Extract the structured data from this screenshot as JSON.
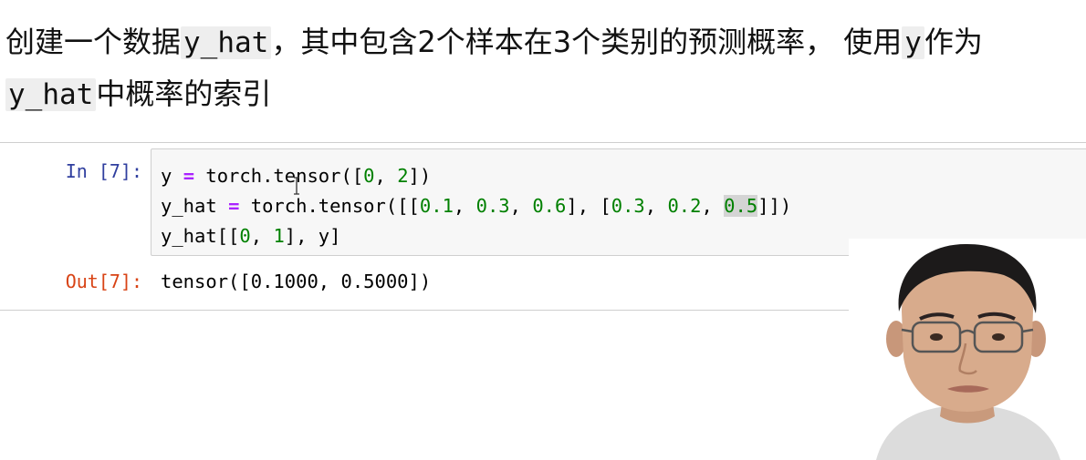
{
  "markdown": {
    "line1": [
      {
        "t": "创建一个数据",
        "code": false
      },
      {
        "t": "y_hat",
        "code": true
      },
      {
        "t": "，其中包含2个样本在3个类别的预测概率， 使用",
        "code": false
      },
      {
        "t": "y",
        "code": true
      },
      {
        "t": "作为",
        "code": false
      }
    ],
    "line2": [
      {
        "t": "y_hat",
        "code": true
      },
      {
        "t": "中概率的索引",
        "code": false
      }
    ]
  },
  "cell": {
    "in_prompt": "In [7]:",
    "out_prompt": "Out[7]:",
    "code_lines": [
      [
        {
          "t": "y ",
          "c": ""
        },
        {
          "t": "=",
          "c": "op"
        },
        {
          "t": " torch.tensor([",
          "c": ""
        },
        {
          "t": "0",
          "c": "num"
        },
        {
          "t": ", ",
          "c": ""
        },
        {
          "t": "2",
          "c": "num"
        },
        {
          "t": "])",
          "c": ""
        }
      ],
      [
        {
          "t": "y_hat ",
          "c": ""
        },
        {
          "t": "=",
          "c": "op"
        },
        {
          "t": " torch.tensor([[",
          "c": ""
        },
        {
          "t": "0.1",
          "c": "num"
        },
        {
          "t": ", ",
          "c": ""
        },
        {
          "t": "0.3",
          "c": "num"
        },
        {
          "t": ", ",
          "c": ""
        },
        {
          "t": "0.6",
          "c": "num"
        },
        {
          "t": "], [",
          "c": ""
        },
        {
          "t": "0.3",
          "c": "num"
        },
        {
          "t": ", ",
          "c": ""
        },
        {
          "t": "0.2",
          "c": "num"
        },
        {
          "t": ", ",
          "c": ""
        },
        {
          "t": "0.5",
          "c": "num hl"
        },
        {
          "t": "]])",
          "c": ""
        }
      ],
      [
        {
          "t": "y_hat[[",
          "c": ""
        },
        {
          "t": "0",
          "c": "num"
        },
        {
          "t": ", ",
          "c": ""
        },
        {
          "t": "1",
          "c": "num"
        },
        {
          "t": "], y]",
          "c": ""
        }
      ]
    ],
    "output": "tensor([0.1000, 0.5000])"
  },
  "colors": {
    "in_prompt": "#303f9f",
    "out_prompt": "#d84315",
    "operator": "#aa22ff",
    "number": "#008000",
    "input_bg": "#f7f7f7"
  },
  "icons": {
    "cursor": "text-cursor-icon"
  }
}
